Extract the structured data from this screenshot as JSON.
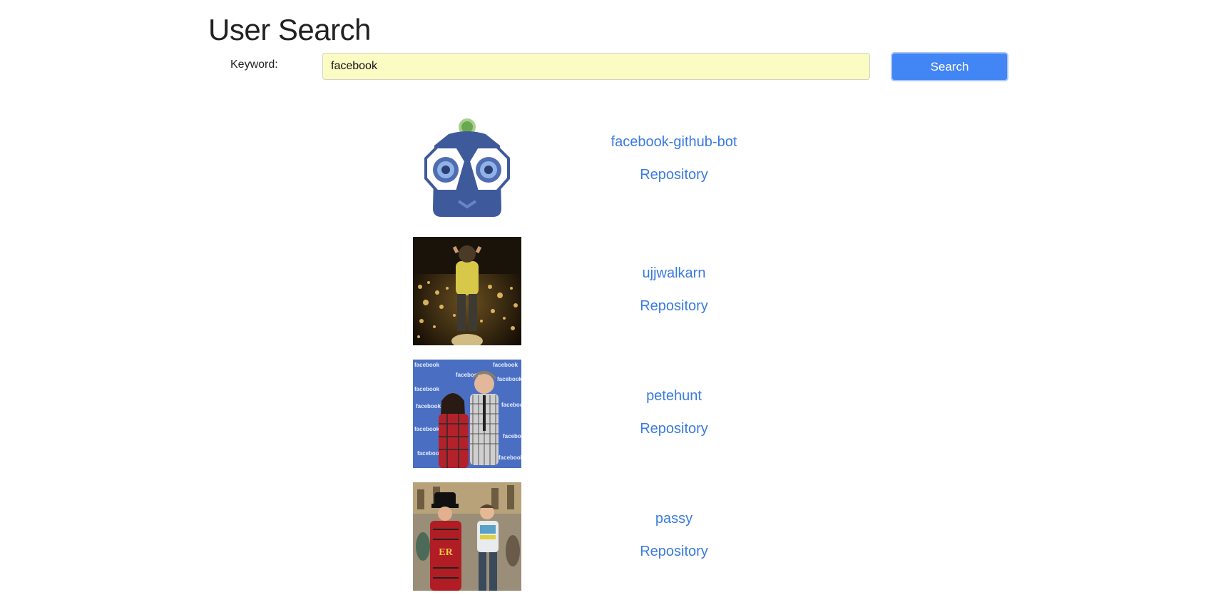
{
  "page": {
    "title": "User Search"
  },
  "search": {
    "label": "Keyword:",
    "value": "facebook",
    "button_label": "Search"
  },
  "colors": {
    "accent": "#4285f4",
    "link": "#3a7be0",
    "input_bg": "#fbfbc4"
  },
  "results": [
    {
      "username": "facebook-github-bot",
      "repo_label": "Repository",
      "avatar": "robot-avatar"
    },
    {
      "username": "ujjwalkarn",
      "repo_label": "Repository",
      "avatar": "city-lights-photo"
    },
    {
      "username": "petehunt",
      "repo_label": "Repository",
      "avatar": "facebook-backdrop-photo"
    },
    {
      "username": "passy",
      "repo_label": "Repository",
      "avatar": "beefeater-photo"
    }
  ],
  "avatar_logo_text": "facebook"
}
